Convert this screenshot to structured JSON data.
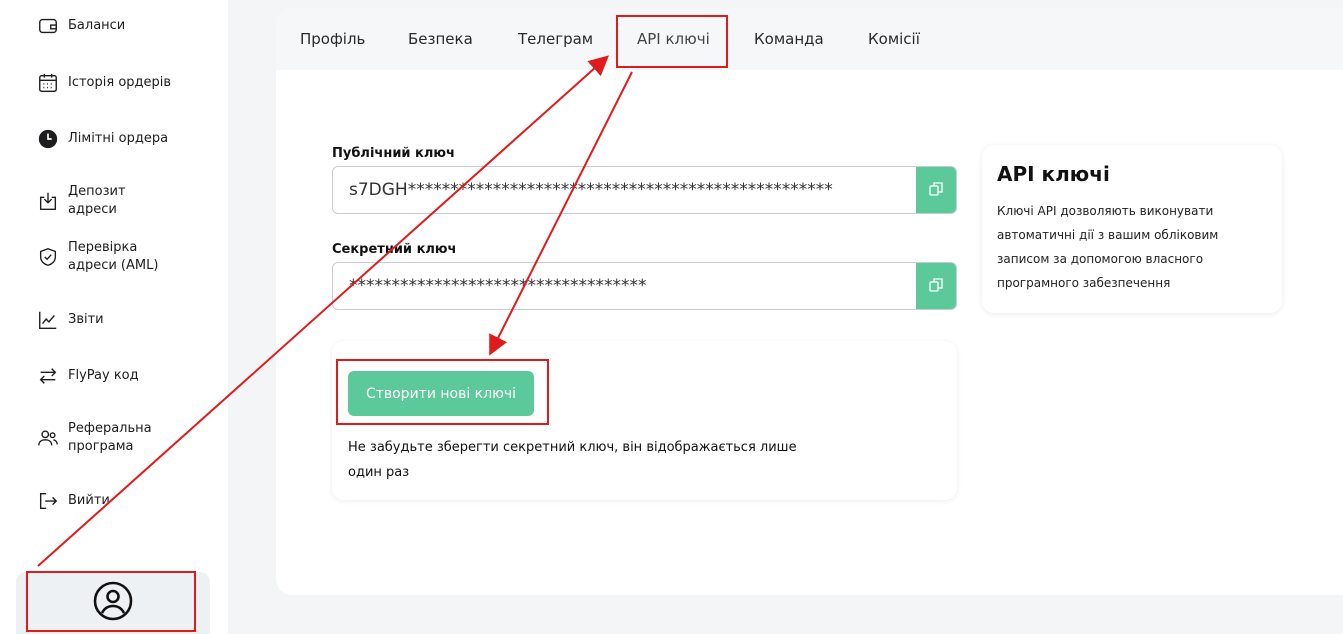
{
  "sidebar": {
    "items": [
      {
        "label": "Баланси",
        "icon": "wallet-icon"
      },
      {
        "label": "Історія ордерів",
        "icon": "calendar-icon"
      },
      {
        "label": "Лімітні ордера",
        "icon": "clock-icon"
      },
      {
        "label": "Депозит адреси",
        "icon": "deposit-icon"
      },
      {
        "label": "Перевірка адреси (AML)",
        "icon": "shield-check-icon"
      },
      {
        "label": "Звіти",
        "icon": "chart-icon"
      },
      {
        "label": "FlyPay код",
        "icon": "transfer-arrows-icon"
      },
      {
        "label": "Реферальна програма",
        "icon": "users-icon"
      },
      {
        "label": "Вийти",
        "icon": "logout-icon"
      }
    ],
    "profile_icon": "user-circle-icon"
  },
  "tabs": [
    {
      "label": "Профіль"
    },
    {
      "label": "Безпека"
    },
    {
      "label": "Телеграм"
    },
    {
      "label": "API ключі",
      "active": true
    },
    {
      "label": "Команда"
    },
    {
      "label": "Комісії"
    }
  ],
  "public_key": {
    "label": "Публічний ключ",
    "value": "s7DGH**************************************************"
  },
  "secret_key": {
    "label": "Секретний ключ",
    "value": "***********************************"
  },
  "generate": {
    "button_label": "Створити нові ключі",
    "note": "Не забудьте зберегти секретний ключ, він відображається лише один раз"
  },
  "info": {
    "title": "API ключі",
    "text": "Ключі API дозволяють виконувати автоматичні дії з вашим обліковим записом за допомогою власного програмного забезпечення"
  },
  "colors": {
    "accent": "#5cc99a",
    "annotation": "#e01b1b"
  }
}
